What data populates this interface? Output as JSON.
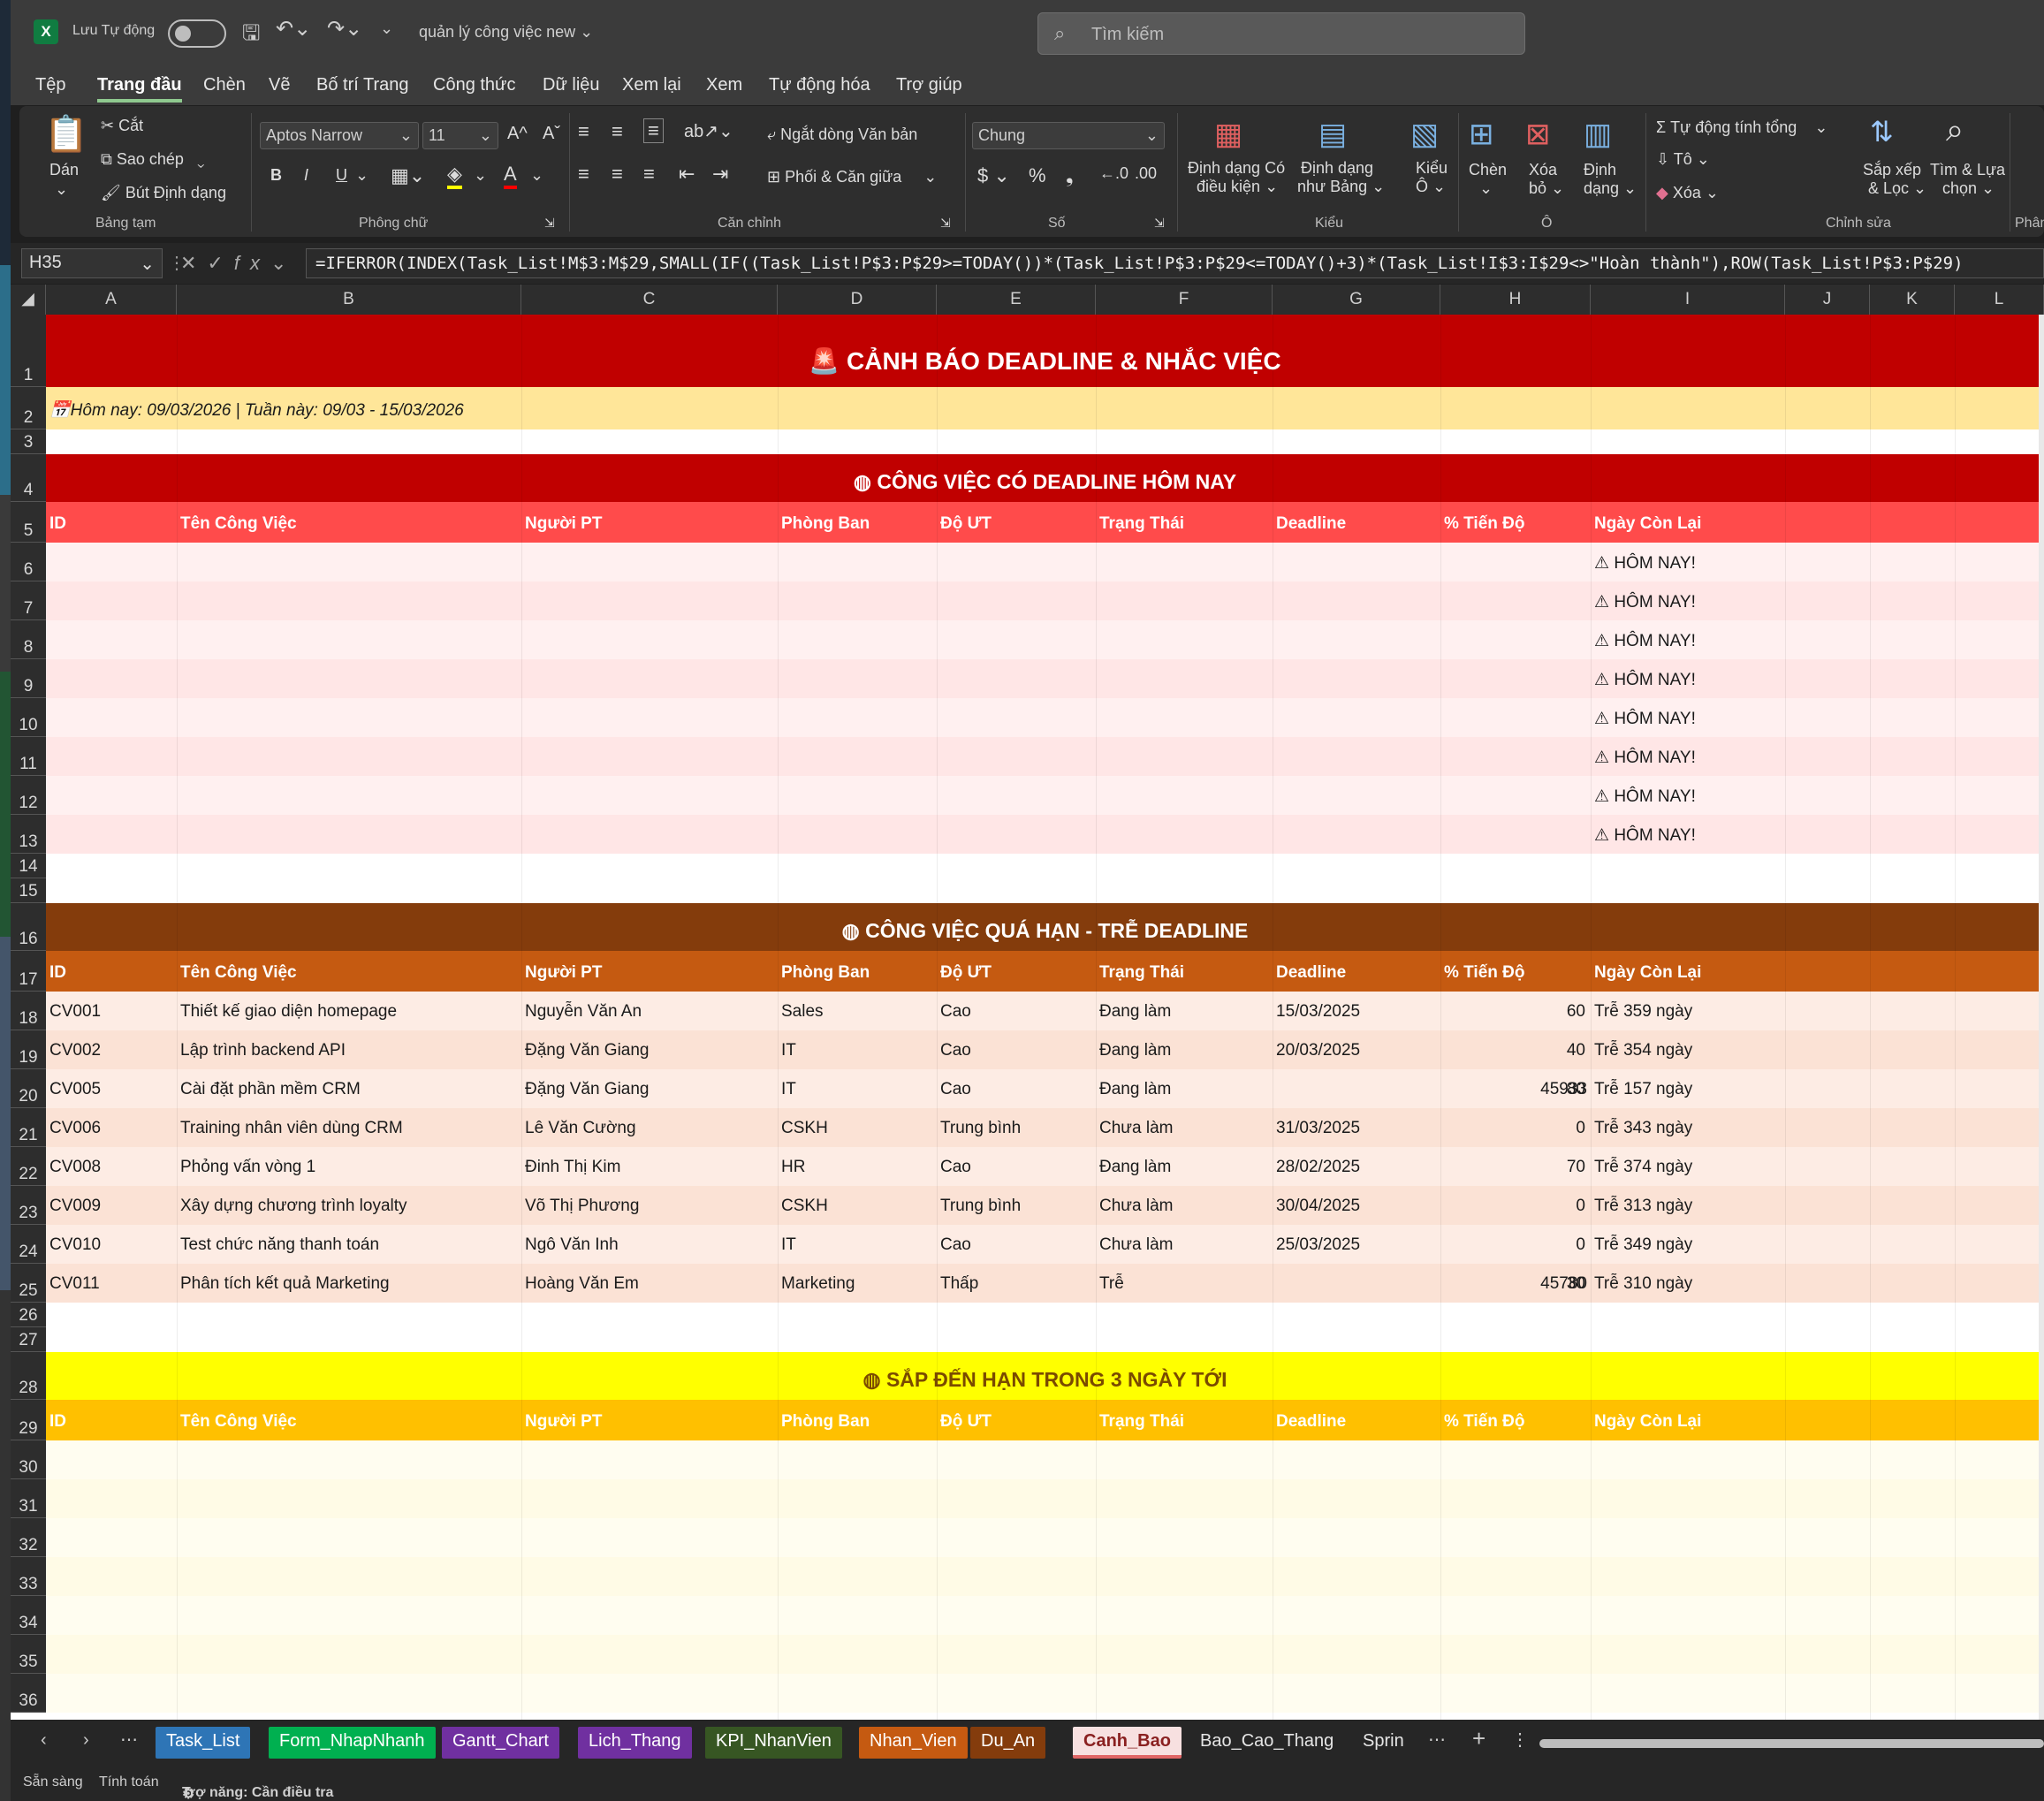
{
  "titlebar": {
    "autosave_label": "Lưu Tự động",
    "doc_title": "quản lý công việc new",
    "search_placeholder": "Tìm kiếm"
  },
  "menu": [
    "Tệp",
    "Trang đầu",
    "Chèn",
    "Vẽ",
    "Bố trí Trang",
    "Công thức",
    "Dữ liệu",
    "Xem lại",
    "Xem",
    "Tự động hóa",
    "Trợ giúp"
  ],
  "ribbon": {
    "clipboard": {
      "paste": "Dán",
      "cut": "Cắt",
      "copy": "Sao chép",
      "format_painter": "Bút Định dạng",
      "group": "Bảng tạm"
    },
    "font": {
      "name": "Aptos Narrow",
      "size": "11",
      "bold": "B",
      "italic": "I",
      "underline": "U",
      "group": "Phông chữ"
    },
    "alignment": {
      "wrap": "Ngắt dòng Văn bản",
      "merge": "Phối & Căn giữa",
      "group": "Căn chỉnh"
    },
    "number": {
      "format": "Chung",
      "group": "Số"
    },
    "styles": {
      "conditional_1": "Định dạng Có",
      "conditional_2": "điều kiện",
      "as_table_1": "Định dạng",
      "as_table_2": "như Bảng",
      "cell_styles_1": "Kiểu",
      "cell_styles_2": "Ô",
      "group": "Kiểu"
    },
    "cells": {
      "insert": "Chèn",
      "delete_1": "Xóa",
      "delete_2": "bỏ",
      "format_1": "Định",
      "format_2": "dạng",
      "group": "Ô"
    },
    "editing": {
      "autosum": "Tự động tính tổng",
      "fill": "Tô",
      "clear": "Xóa",
      "sort_1": "Sắp xếp",
      "sort_2": "& Lọc",
      "find_1": "Tìm & Lựa",
      "find_2": "chọn",
      "group": "Chỉnh sửa"
    },
    "next_group_cut": "Phân"
  },
  "formula_bar": {
    "name_box": "H35",
    "formula": "=IFERROR(INDEX(Task_List!M$3:M$29,SMALL(IF((Task_List!P$3:P$29>=TODAY())*(Task_List!P$3:P$29<=TODAY()+3)*(Task_List!I$3:I$29<>\"Hoàn thành\"),ROW(Task_List!P$3:P$29)"
  },
  "columns": [
    "A",
    "B",
    "C",
    "D",
    "E",
    "F",
    "G",
    "H",
    "I",
    "J",
    "K",
    "L"
  ],
  "sheet": {
    "title": "CẢNH BÁO DEADLINE & NHẮC VIỆC",
    "date_line": "Hôm nay: 09/03/2026  |  Tuần này: 09/03 - 15/03/2026",
    "headers": [
      "ID",
      "Tên Công Việc",
      "Người PT",
      "Phòng Ban",
      "Độ ƯT",
      "Trạng Thái",
      "Deadline",
      "% Tiến Độ",
      "Ngày Còn Lại"
    ],
    "today_section": "CÔNG VIỆC CÓ DEADLINE HÔM NAY",
    "today_flag": "HÔM NAY!",
    "overdue_section": "CÔNG VIỆC QUÁ HẠN - TRỄ DEADLINE",
    "overdue_rows": [
      [
        "CV001",
        "Thiết kế giao diện homepage",
        "Nguyễn Văn An",
        "Sales",
        "Cao",
        "Đang làm",
        "15/03/2025",
        "",
        "60",
        "Trễ 359 ngày"
      ],
      [
        "CV002",
        "Lập trình backend API",
        "Đặng Văn Giang",
        "IT",
        "Cao",
        "Đang làm",
        "20/03/2025",
        "",
        "40",
        "Trễ 354 ngày"
      ],
      [
        "CV005",
        "Cài đặt phần mềm CRM",
        "Đặng Văn Giang",
        "IT",
        "Cao",
        "Đang làm",
        "",
        "45933",
        "80",
        "Trễ 157 ngày"
      ],
      [
        "CV006",
        "Training nhân viên dùng CRM",
        "Lê Văn Cường",
        "CSKH",
        "Trung bình",
        "Chưa làm",
        "31/03/2025",
        "",
        "0",
        "Trễ 343 ngày"
      ],
      [
        "CV008",
        "Phỏng vấn vòng 1",
        "Đinh Thị Kim",
        "HR",
        "Cao",
        "Đang làm",
        "28/02/2025",
        "",
        "70",
        "Trễ 374 ngày"
      ],
      [
        "CV009",
        "Xây dựng chương trình loyalty",
        "Võ Thị Phương",
        "CSKH",
        "Trung bình",
        "Chưa làm",
        "30/04/2025",
        "",
        "0",
        "Trễ 313 ngày"
      ],
      [
        "CV010",
        "Test chức năng thanh toán",
        "Ngô Văn Inh",
        "IT",
        "Cao",
        "Chưa làm",
        "25/03/2025",
        "",
        "0",
        "Trễ 349 ngày"
      ],
      [
        "CV011",
        "Phân tích kết quả Marketing",
        "Hoàng Văn Em",
        "Marketing",
        "Thấp",
        "Trễ",
        "",
        "45780",
        "30",
        "Trễ 310 ngày"
      ]
    ],
    "upcoming_section": "SẮP ĐẾN HẠN TRONG 3 NGÀY TỚI"
  },
  "tabs": [
    {
      "label": "Task_List",
      "color": "#2e75b6"
    },
    {
      "label": "Form_NhapNhanh",
      "color": "#00b050"
    },
    {
      "label": "Gantt_Chart",
      "color": "#7030a0"
    },
    {
      "label": "Lich_Thang",
      "color": "#7030a0"
    },
    {
      "label": "KPI_NhanVien",
      "color": "#375623"
    },
    {
      "label": "Nhan_Vien",
      "color": "#c55a11"
    },
    {
      "label": "Du_An",
      "color": "#843c0c"
    },
    {
      "label": "Canh_Bao",
      "color": "#f4b6b6"
    },
    {
      "label": "Bao_Cao_Thang",
      "color": ""
    },
    {
      "label": "Sprin",
      "color": ""
    }
  ],
  "status": {
    "ready": "Sẵn sàng",
    "calc": "Tính toán",
    "accessibility": "Trợ năng: Cần điều tra"
  },
  "colors": {
    "title_red": "#c00000",
    "section_red": "#c00000",
    "header_red": "#ff4b4b",
    "overdue_brown": "#843c0c",
    "overdue_header": "#c55a11",
    "upcoming_yellow": "#ffff00",
    "upcoming_header": "#ffc000"
  }
}
